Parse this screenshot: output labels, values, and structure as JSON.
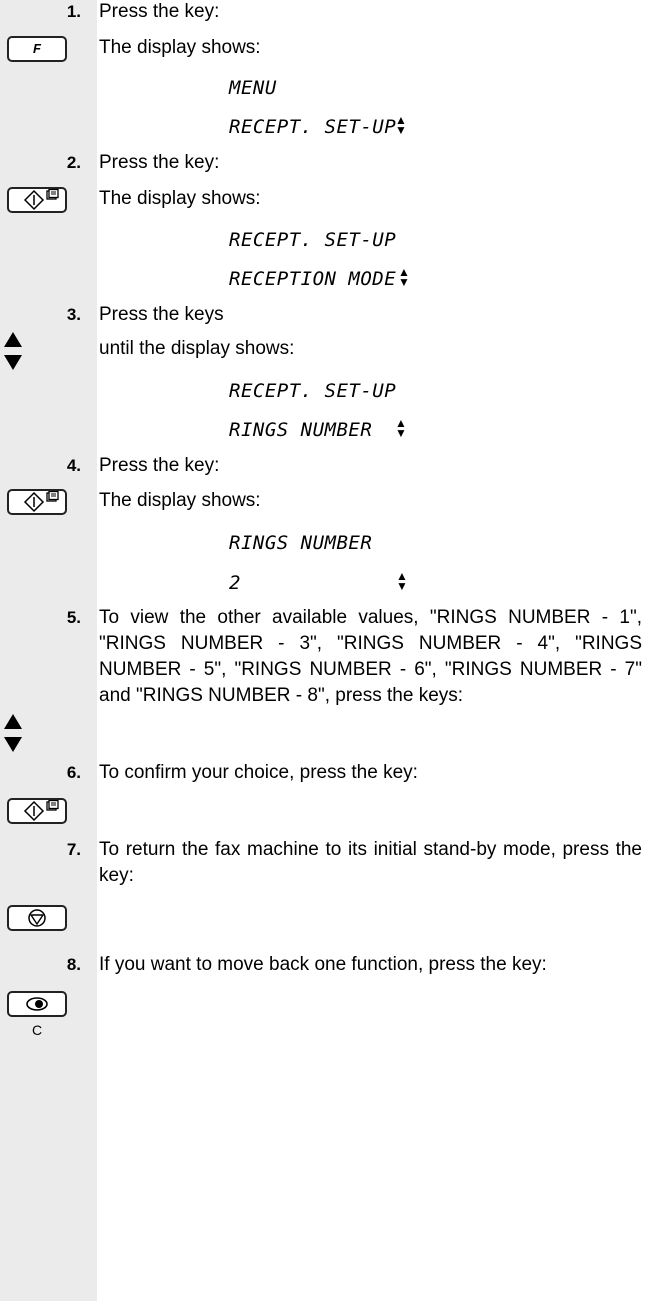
{
  "steps": [
    {
      "num": "1.",
      "text": "Press the key:"
    },
    {
      "num": "2.",
      "text": "Press the key:"
    },
    {
      "num": "3.",
      "text": "Press the keys"
    },
    {
      "num": "4.",
      "text": "Press the key:"
    },
    {
      "num": "5.",
      "text": "To view the other available values, \"RINGS NUMBER - 1\", \"RINGS NUMBER - 3\", \"RINGS NUMBER - 4\", \"RINGS NUMBER - 5\", \"RINGS NUMBER - 6\", \"RINGS NUMBER - 7\" and \"RINGS NUMBER - 8\", press the keys:"
    },
    {
      "num": "6.",
      "text": "To confirm your choice, press the key:"
    },
    {
      "num": "7.",
      "text": "To return the fax machine to its initial stand-by mode, press the key:"
    },
    {
      "num": "8.",
      "text": "If you want to move back one function, press the key:"
    }
  ],
  "display_label": "The display shows:",
  "until_label": "until the display shows:",
  "displays": [
    {
      "line1": "MENU",
      "line2": "RECEPT. SET-UP"
    },
    {
      "line1": "RECEPT. SET-UP",
      "line2": "RECEPTION MODE"
    },
    {
      "line1": "RECEPT. SET-UP",
      "line2": "RINGS NUMBER"
    },
    {
      "line1": "RINGS NUMBER",
      "line2": "2"
    }
  ],
  "keys": {
    "function_key_letter": "F",
    "clear_key_letter": "C"
  },
  "icons": {
    "arrow_up": "▲",
    "arrow_down": "▼",
    "function": "f-key-icon",
    "start": "start-copy-icon",
    "stop": "stop-icon",
    "clear": "clear-icon"
  }
}
